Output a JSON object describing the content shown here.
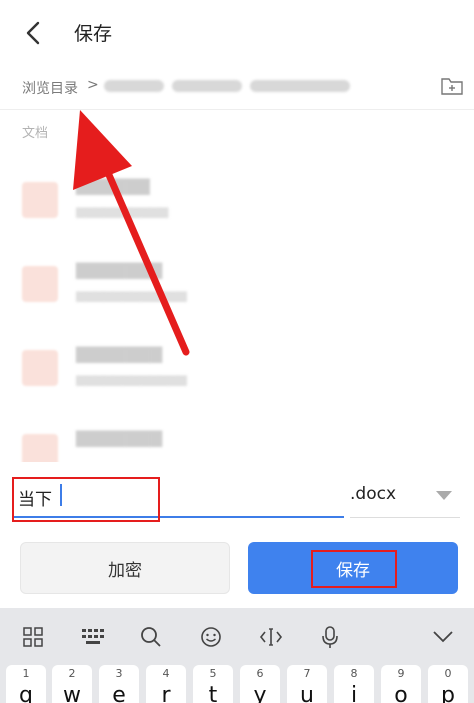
{
  "header": {
    "title": "保存"
  },
  "breadcrumb": {
    "root": "浏览目录",
    "separator": ">"
  },
  "section_label": "文档",
  "file_list": {
    "blurred": true,
    "items": [
      {
        "name": "",
        "meta": ""
      },
      {
        "name": "",
        "meta": ""
      },
      {
        "name": "",
        "meta": ""
      },
      {
        "name": "",
        "meta": ""
      }
    ]
  },
  "filename_input": {
    "value": "当下"
  },
  "extension_select": {
    "selected": ".docx"
  },
  "buttons": {
    "encrypt": "加密",
    "save": "保存"
  },
  "keyboard": {
    "tools": [
      "apps-grid-icon",
      "keyboard-icon",
      "search-icon",
      "emoji-icon",
      "cursor-icon",
      "microphone-icon",
      "collapse-icon"
    ],
    "number_row": [
      "1",
      "2",
      "3",
      "4",
      "5",
      "6",
      "7",
      "8",
      "9",
      "0"
    ],
    "letter_row": [
      "q",
      "w",
      "e",
      "r",
      "t",
      "y",
      "u",
      "i",
      "o",
      "p"
    ]
  },
  "colors": {
    "accent": "#3f82ee",
    "annotation_red": "#e51d1d"
  }
}
